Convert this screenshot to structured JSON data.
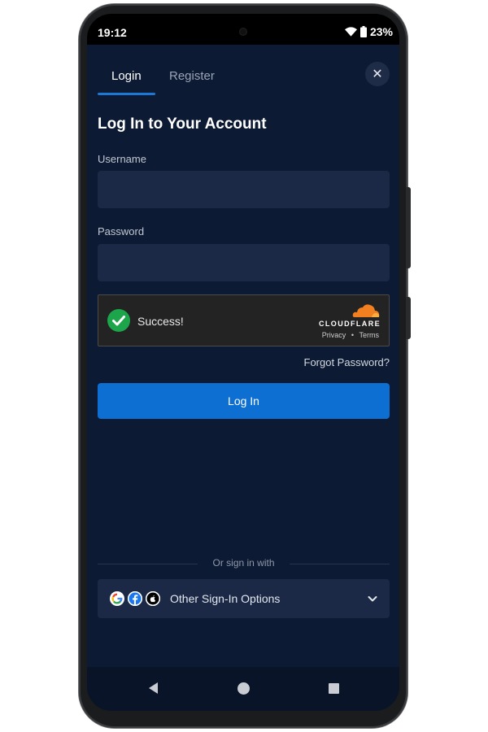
{
  "status_bar": {
    "time": "19:12",
    "battery": "23%",
    "icons": [
      "wifi-icon",
      "battery-icon"
    ]
  },
  "tabs": [
    {
      "label": "Login",
      "active": true
    },
    {
      "label": "Register",
      "active": false
    }
  ],
  "close": {
    "icon": "close-icon",
    "glyph": "✕"
  },
  "form": {
    "title": "Log In to Your Account",
    "username_label": "Username",
    "username_value": "",
    "password_label": "Password",
    "password_value": ""
  },
  "captcha": {
    "status": "Success!",
    "brand": "CLOUDFLARE",
    "privacy": "Privacy",
    "separator": "•",
    "terms": "Terms"
  },
  "forgot_password": "Forgot Password?",
  "login_button": "Log In",
  "alt_signin": {
    "divider": "Or sign in with",
    "label": "Other Sign-In Options",
    "providers": [
      "google-icon",
      "facebook-icon",
      "apple-icon"
    ]
  },
  "nav": {
    "icons": [
      "back-icon",
      "home-icon",
      "recents-icon"
    ]
  },
  "colors": {
    "background": "#0c1a33",
    "input": "#1b2947",
    "accent": "#0d6fd1",
    "success": "#1ca54a",
    "cloudflare": "#f38020"
  }
}
